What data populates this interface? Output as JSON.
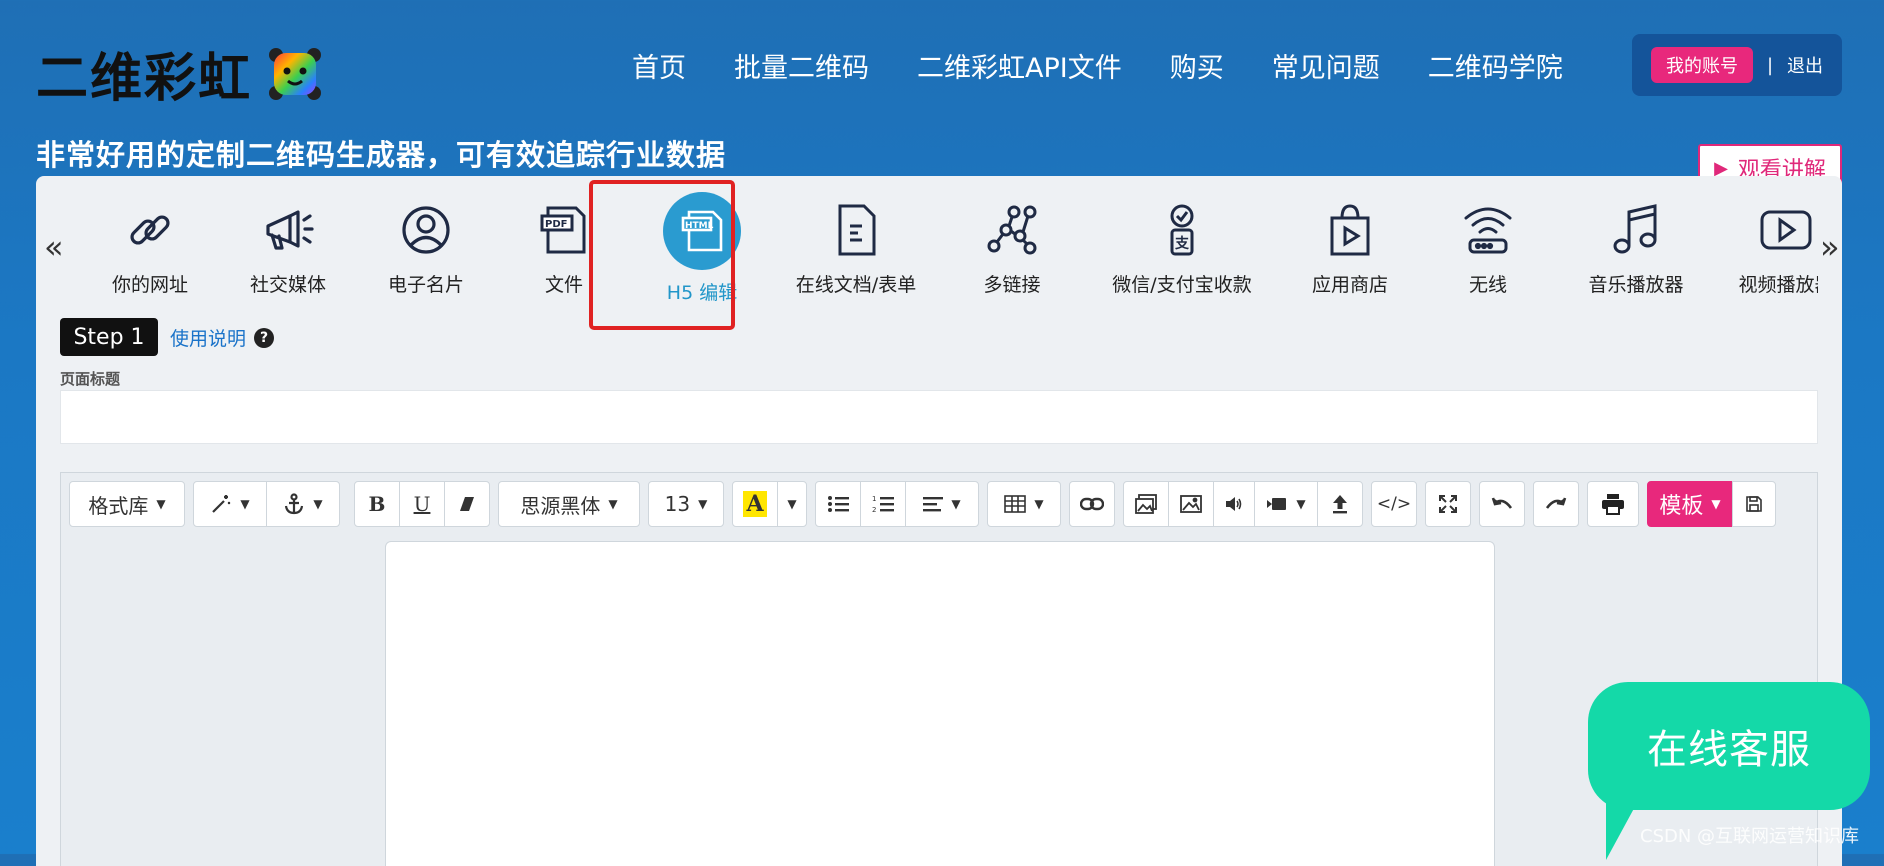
{
  "brand": {
    "name": "二维彩虹"
  },
  "nav": {
    "items": [
      "首页",
      "批量二维码",
      "二维彩虹API文件",
      "购买",
      "常见问题",
      "二维码学院"
    ]
  },
  "account": {
    "my_account": "我的账号",
    "separator": "|",
    "logout": "退出"
  },
  "tagline": "非常好用的定制二维码生成器，可有效追踪行业数据",
  "watch": {
    "label": "观看讲解",
    "icon": "play-icon"
  },
  "types": {
    "prev_arrow": "«",
    "next_arrow": "»",
    "items": [
      {
        "label": "你的网址",
        "icon": "link-icon"
      },
      {
        "label": "社交媒体",
        "icon": "megaphone-icon"
      },
      {
        "label": "电子名片",
        "icon": "user-circle-icon"
      },
      {
        "label": "文件",
        "icon": "pdf-icon"
      },
      {
        "label": "H5 编辑",
        "icon": "html-icon",
        "active": true
      },
      {
        "label": "在线文档/表单",
        "icon": "document-icon"
      },
      {
        "label": "多链接",
        "icon": "network-icon"
      },
      {
        "label": "微信/支付宝收款",
        "icon": "payment-icon"
      },
      {
        "label": "应用商店",
        "icon": "shopping-bag-icon"
      },
      {
        "label": "无线",
        "icon": "wifi-icon"
      },
      {
        "label": "音乐播放器",
        "icon": "music-icon"
      },
      {
        "label": "视频播放器",
        "icon": "video-icon"
      }
    ]
  },
  "step": {
    "label": "Step 1",
    "help": "使用说明",
    "help_icon": "question-icon"
  },
  "form": {
    "title_label": "页面标题",
    "title_value": "",
    "title_placeholder": ""
  },
  "toolbar": {
    "style_lib": "格式库",
    "font_family": "思源黑体",
    "font_size": "13",
    "template": "模板",
    "bold": "B",
    "underline": "U",
    "highlight": "A",
    "code": "</>"
  },
  "chat": {
    "label": "在线客服"
  },
  "watermark": "CSDN @互联网运营知识库",
  "colors": {
    "accent": "#e8287c",
    "brand_blue": "#1b78c4",
    "chat_green": "#14d9a8",
    "active_blue": "#2a9bd0",
    "highlight_red": "#e02222"
  }
}
